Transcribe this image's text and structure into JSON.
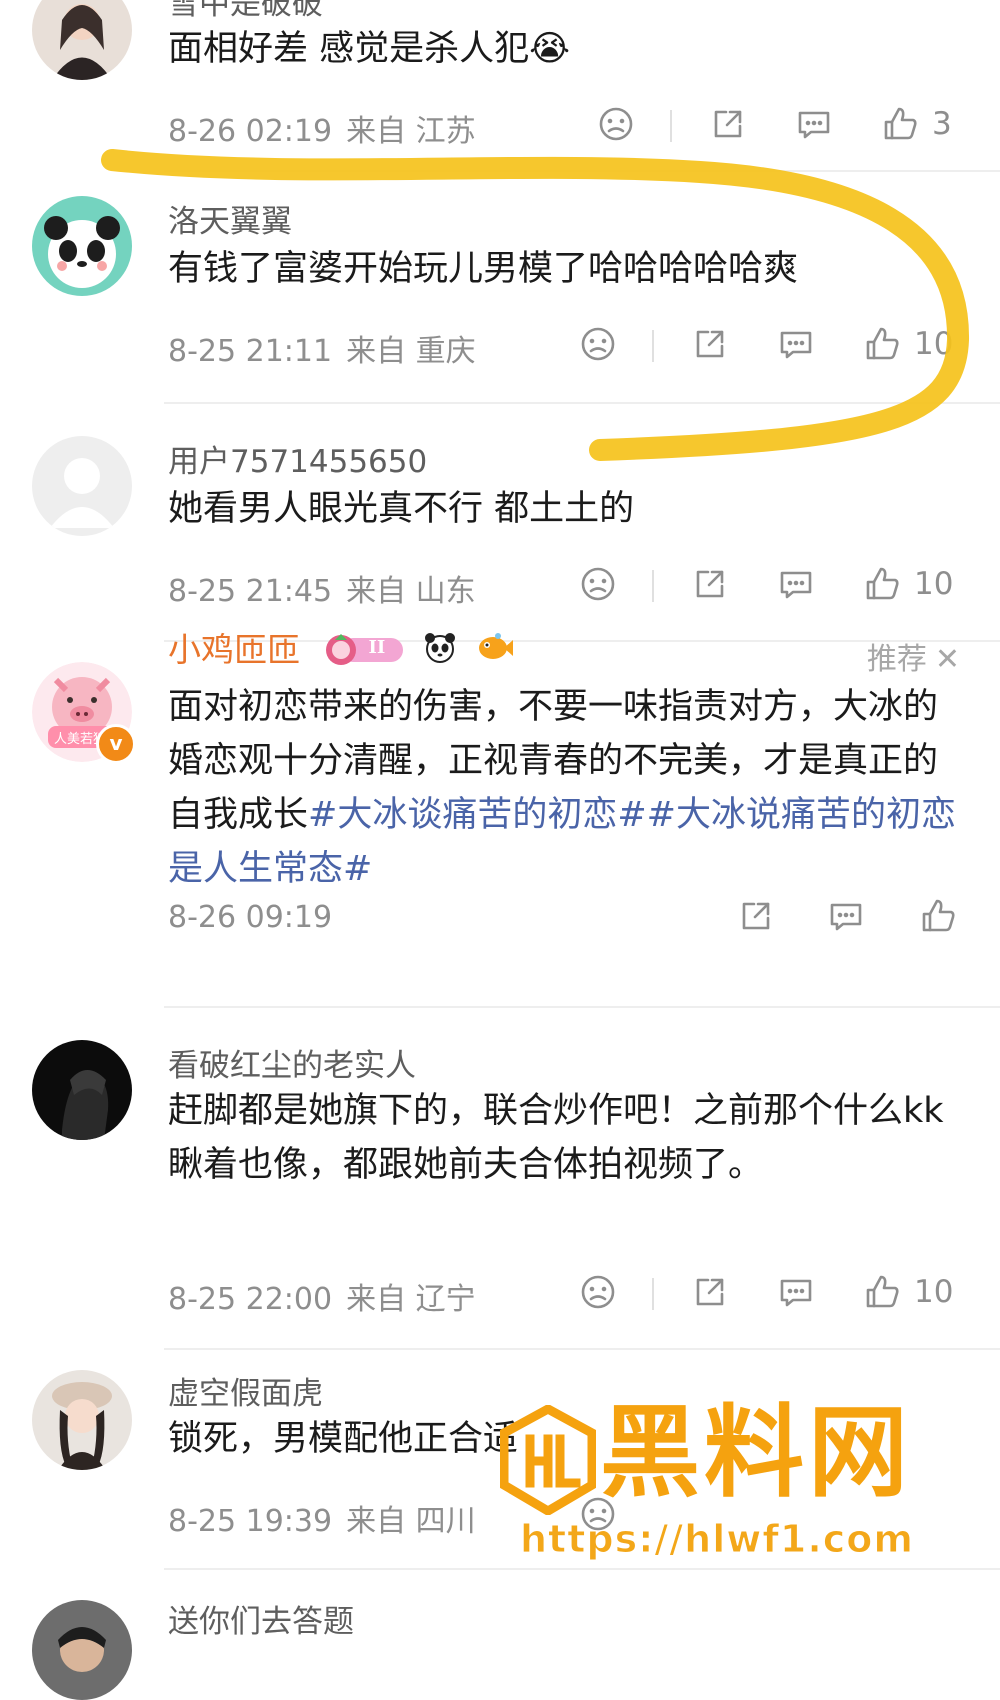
{
  "comments": [
    {
      "name": "雪中是破破",
      "text": "面相好差 感觉是杀人犯",
      "emoji": "😭",
      "date": "8-26 02:19",
      "location": "来自 江苏",
      "likes": "3"
    },
    {
      "name": "洛天翼翼",
      "text": "有钱了富婆开始玩儿男模了哈哈哈哈哈爽",
      "date": "8-25 21:11",
      "location": "来自 重庆",
      "likes": "10"
    },
    {
      "name": "用户7571455650",
      "text": "她看男人眼光真不行 都土土的",
      "date": "8-25 21:45",
      "location": "来自 山东",
      "likes": "10"
    },
    {
      "name": "小鸡匝匝",
      "recommend": "推荐",
      "badge_level": "II",
      "avatar_label": "人美若猪",
      "text_plain": "面对初恋带来的伤害，不要一味指责对方，大冰的婚恋观十分清醒，正视青春的不完美，才是真正的自我成长",
      "tag1": "#大冰谈痛苦的初恋#",
      "tag2": "#大冰说痛苦的初恋是人生常态#",
      "date": "8-26 09:19"
    },
    {
      "name": "看破红尘的老实人",
      "text": "赶脚都是她旗下的，联合炒作吧！之前那个什么kk瞅着也像，都跟她前夫合体拍视频了。",
      "date": "8-25 22:00",
      "location": "来自 辽宁",
      "likes": "10"
    },
    {
      "name": "虚空假面虎",
      "text": "锁死，男模配他正合适",
      "date": "8-25 19:39",
      "location": "来自 四川"
    },
    {
      "name": "送你们去答题"
    }
  ],
  "watermark": {
    "title": "黑料网",
    "url": "https://hlwf1.com"
  },
  "colors": {
    "highlight": "#f5c21b",
    "name_vip": "#e8742b",
    "hashtag": "#4a64a8",
    "meta": "#8e8e8e"
  }
}
